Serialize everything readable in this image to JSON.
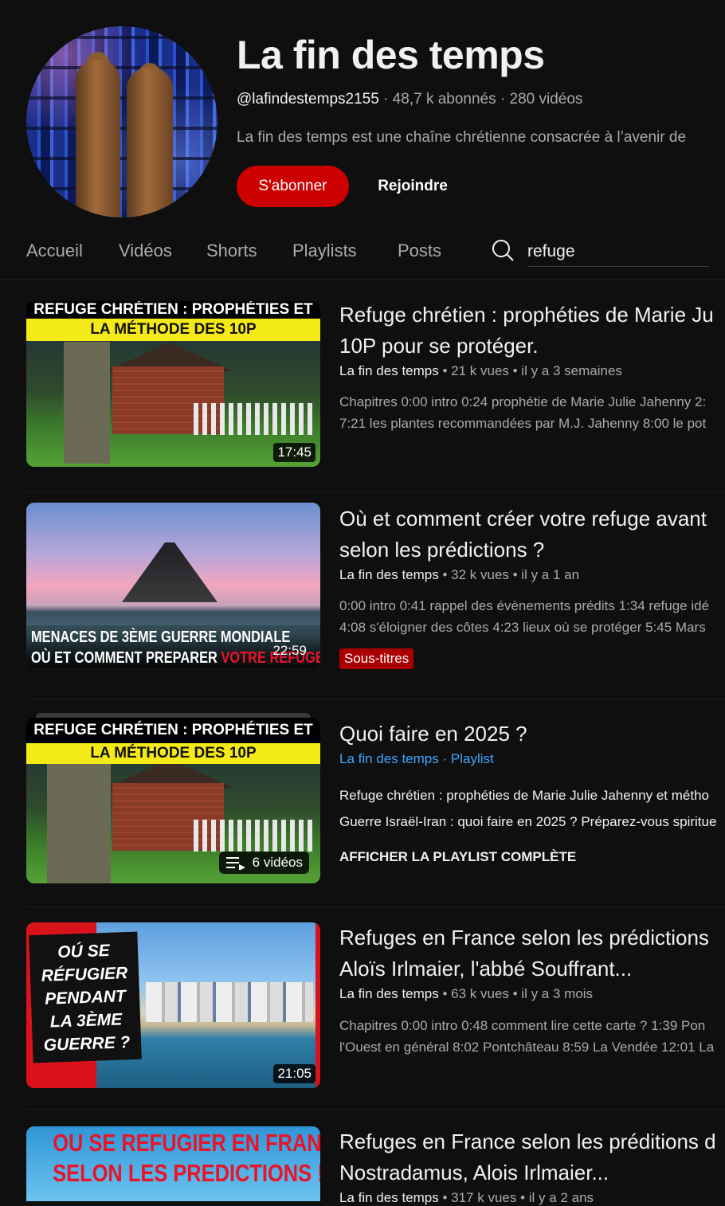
{
  "channel": {
    "name": "La fin des temps",
    "handle": "@lafindestemps2155",
    "stats": "· 48,7 k abonnés · 280 vidéos",
    "description": "La fin des temps est une chaîne chrétienne consacrée à l’avenir de",
    "subscribe_label": "S'abonner",
    "join_label": "Rejoindre"
  },
  "tabs": [
    {
      "label": "Accueil"
    },
    {
      "label": "Vidéos"
    },
    {
      "label": "Shorts"
    },
    {
      "label": "Playlists"
    },
    {
      "label": "Posts"
    }
  ],
  "search": {
    "value": "refuge",
    "icon": "search-icon"
  },
  "results": [
    {
      "title_line1": "Refuge chrétien : prophéties de Marie Ju",
      "title_line2": "10P pour se protéger.",
      "channel": "La fin des temps",
      "meta": " • 21 k vues • il y a 3 semaines",
      "desc1": "Chapitres 0:00 intro 0:24 prophétie de Marie Julie Jahenny 2:",
      "desc2": "7:21 les plantes recommandées par M.J. Jahenny 8:00 le pot",
      "duration": "17:45",
      "thumb_banner1": "REFUGE CHRÉTIEN : PROPHÉTIES ET",
      "thumb_banner2": "LA MÉTHODE DES 10P"
    },
    {
      "title_line1": "Où et comment créer votre refuge avant",
      "title_line2": "selon les prédictions ?",
      "channel": "La fin des temps",
      "meta": " • 32 k vues • il y a 1 an",
      "desc1": "0:00 intro 0:41 rappel des évènements prédits 1:34 refuge idé",
      "desc2": "4:08 s'éloigner des côtes 4:23 lieux où se protéger 5:45 Mars",
      "badge": "Sous-titres",
      "duration": "22:59",
      "thumb_text1": "MENACES DE 3ÈME GUERRE MONDIALE",
      "thumb_text2a": "OÙ ET COMMENT PREPARER ",
      "thumb_text2b": "VOTRE REFUGE ?"
    },
    {
      "title_line1": "Quoi faire en 2025 ?",
      "channel": "La fin des temps",
      "type": "· Playlist",
      "desc1": "Refuge chrétien : prophéties de Marie Julie Jahenny et métho",
      "desc2": "Guerre Israël-Iran : quoi faire en 2025 ? Préparez-vous spiritue",
      "view_all": "AFFICHER LA PLAYLIST COMPLÈTE",
      "count": "6 vidéos",
      "thumb_banner1": "REFUGE CHRÉTIEN : PROPHÉTIES ET",
      "thumb_banner2": "LA MÉTHODE DES 10P"
    },
    {
      "title_line1": "Refuges en France selon les prédictions",
      "title_line2": "Aloïs Irlmaier, l'abbé Souffrant...",
      "channel": "La fin des temps",
      "meta": " • 63 k vues • il y a 3 mois",
      "desc1": "Chapitres 0:00 intro 0:48 comment lire cette carte ? 1:39 Pon",
      "desc2": "l'Ouest en général 8:02 Pontchâteau 8:59 La Vendée 12:01 La",
      "duration": "21:05",
      "thumb_text": "OÚ SE RÉFUGIER PENDANT LA 3ÈME GUERRE ?"
    },
    {
      "title_line1": "Refuges en France selon les prédi­tions d",
      "title_line2": "Nostradamus, Alois Irlmaier...",
      "channel": "La fin des temps",
      "meta": " • 317 k vues • il y a 2 ans",
      "thumb_text1": "OU SE REFUGIER EN FRANCE",
      "thumb_text2": "SELON LES PREDICTIONS !"
    }
  ],
  "colors": {
    "background": "#0f0f0f",
    "subscribe": "#cc0000",
    "link": "#3ea6ff",
    "badge": "#aa0000"
  }
}
